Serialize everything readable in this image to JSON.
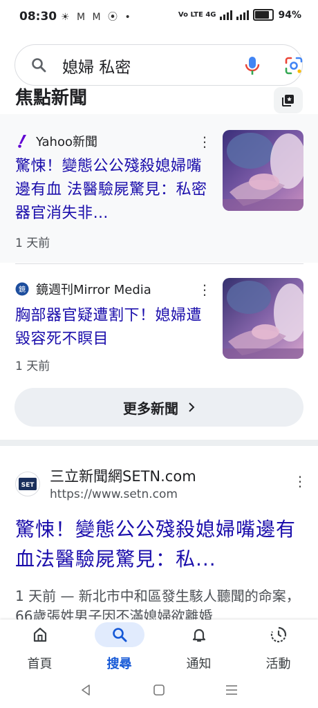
{
  "status_bar": {
    "time": "08:30",
    "notifications": "☀ M M ⦿ •",
    "network": "Vo LTE 4G",
    "battery": "94%"
  },
  "search": {
    "query": "媳婦 私密"
  },
  "top_stories": {
    "title": "焦點新聞",
    "items": [
      {
        "source": "Yahoo新聞",
        "headline": "驚悚！變態公公殘殺媳婦嘴邊有血 法醫驗屍驚見：私密器官消失非…",
        "time_ago": "1 天前"
      },
      {
        "source": "鏡週刊Mirror Media",
        "headline": "胸部器官疑遭割下！媳婦遭毀容死不瞑目",
        "time_ago": "1 天前"
      }
    ],
    "more_button": "更多新聞"
  },
  "result": {
    "site_name": "三立新聞網SETN.com",
    "url": "https://www.setn.com",
    "title": "驚悚！變態公公殘殺媳婦嘴邊有血法醫驗屍驚見：私...",
    "snippet": "1 天前 — 新北市中和區發生駭人聽聞的命案，66歲張姓男子因不滿媳婦欲離婚"
  },
  "bottom_nav": [
    {
      "label": "首頁",
      "icon": "home-icon"
    },
    {
      "label": "搜尋",
      "icon": "search-icon"
    },
    {
      "label": "通知",
      "icon": "bell-icon"
    },
    {
      "label": "活動",
      "icon": "activity-icon"
    }
  ],
  "colors": {
    "link": "#1a0dab",
    "accent": "#1558d6",
    "active_pill": "#e1ebfd"
  }
}
